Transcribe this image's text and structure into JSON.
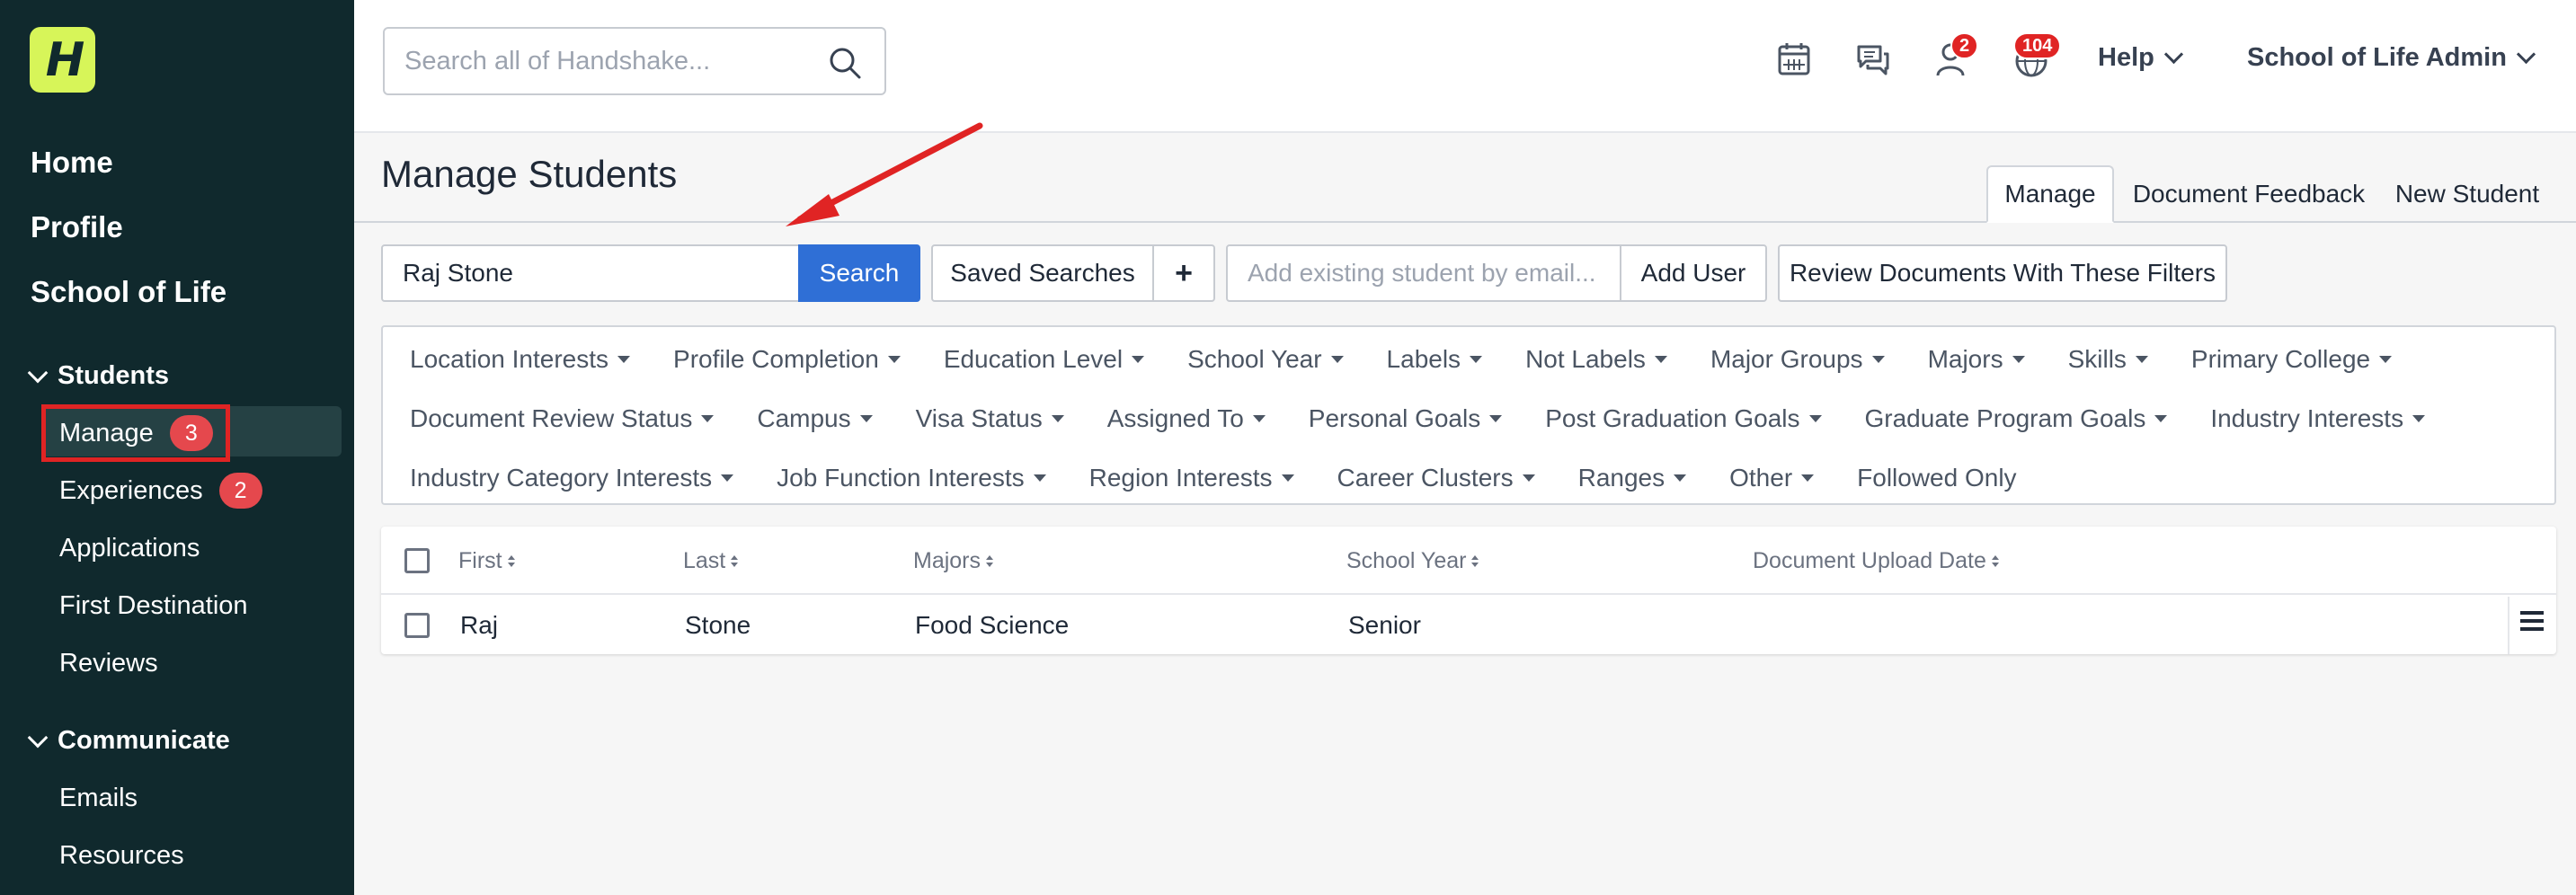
{
  "logo": {
    "letter": "H"
  },
  "sidebar": {
    "top_items": [
      {
        "label": "Home"
      },
      {
        "label": "Profile"
      },
      {
        "label": "School of Life"
      }
    ],
    "students_section": {
      "title": "Students",
      "items": [
        {
          "label": "Manage",
          "badge": "3"
        },
        {
          "label": "Experiences",
          "badge": "2"
        },
        {
          "label": "Applications"
        },
        {
          "label": "First Destination"
        },
        {
          "label": "Reviews"
        }
      ]
    },
    "communicate_section": {
      "title": "Communicate",
      "items": [
        {
          "label": "Emails"
        },
        {
          "label": "Resources"
        }
      ]
    }
  },
  "topbar": {
    "search_placeholder": "Search all of Handshake...",
    "icons": [
      "calendar-icon",
      "messages-icon",
      "person-icon",
      "globe-icon"
    ],
    "person_badge": "2",
    "globe_badge": "104",
    "help_label": "Help",
    "account_label": "School of Life Admin"
  },
  "main": {
    "title": "Manage Students",
    "tabs": [
      {
        "label": "Manage",
        "active": true
      },
      {
        "label": "Document Feedback"
      },
      {
        "label": "New Student"
      }
    ],
    "toolbar": {
      "search_value": "Raj Stone",
      "search_button": "Search",
      "saved_searches": "Saved Searches",
      "plus": "+",
      "add_email_placeholder": "Add existing student by email...",
      "add_user": "Add User",
      "review_documents": "Review Documents With These Filters"
    },
    "filters": {
      "row1": [
        "Location Interests",
        "Profile Completion",
        "Education Level",
        "School Year",
        "Labels",
        "Not Labels",
        "Major Groups",
        "Majors",
        "Skills",
        "Primary College"
      ],
      "row2": [
        "Document Review Status",
        "Campus",
        "Visa Status",
        "Assigned To",
        "Personal Goals",
        "Post Graduation Goals",
        "Graduate Program Goals",
        "Industry Interests"
      ],
      "row3": [
        "Industry Category Interests",
        "Job Function Interests",
        "Region Interests",
        "Career Clusters",
        "Ranges",
        "Other"
      ],
      "followed_only": "Followed Only"
    },
    "table": {
      "headers": [
        "First",
        "Last",
        "Majors",
        "School Year",
        "Document Upload Date"
      ],
      "rows": [
        {
          "first": "Raj",
          "last": "Stone",
          "majors": "Food Science",
          "school_year": "Senior",
          "document_upload_date": ""
        }
      ]
    }
  },
  "colors": {
    "sidebar_bg": "#10292d",
    "logo_bg": "#d7f559",
    "primary_button": "#2f6fd6",
    "badge_red": "#e5484d",
    "annotation_red": "#e02424"
  }
}
